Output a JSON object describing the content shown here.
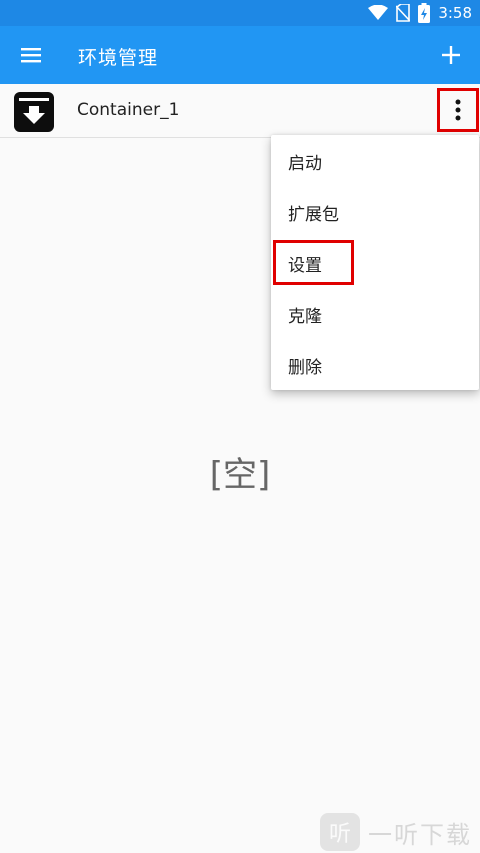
{
  "status_bar": {
    "time": "3:58",
    "icons": [
      "wifi-icon",
      "no-sim-icon",
      "battery-charging-icon"
    ]
  },
  "app_bar": {
    "title": "环境管理",
    "menu_icon": "hamburger-menu-icon",
    "add_icon": "plus-icon"
  },
  "containers": [
    {
      "name": "Container_1",
      "icon": "archive-download-icon",
      "more_icon": "more-vert-icon"
    }
  ],
  "popup_menu": {
    "items": [
      {
        "label": "启动"
      },
      {
        "label": "扩展包"
      },
      {
        "label": "设置"
      },
      {
        "label": "克隆"
      },
      {
        "label": "删除"
      }
    ],
    "highlighted_item": "设置"
  },
  "empty_state": {
    "text": "[空]"
  },
  "watermark": {
    "logo_text": "听",
    "text": "一听下载"
  },
  "colors": {
    "status_bar": "#1e88e5",
    "app_bar": "#2196f3",
    "highlight": "#e00000"
  }
}
